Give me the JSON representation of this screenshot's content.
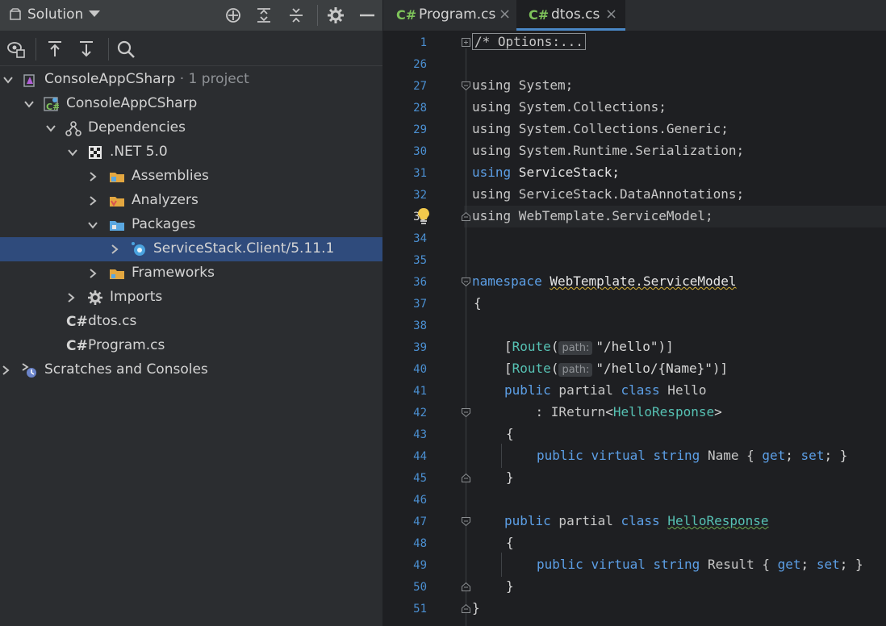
{
  "solution": {
    "title": "Solution"
  },
  "tree": [
    {
      "label": "ConsoleAppCSharp",
      "suffix": " · 1 project"
    },
    {
      "label": "ConsoleAppCSharp"
    },
    {
      "label": "Dependencies"
    },
    {
      "label": ".NET 5.0"
    },
    {
      "label": "Assemblies"
    },
    {
      "label": "Analyzers"
    },
    {
      "label": "Packages"
    },
    {
      "label": "ServiceStack.Client/5.11.1"
    },
    {
      "label": "Frameworks"
    },
    {
      "label": "Imports"
    },
    {
      "label": "dtos.cs",
      "badge": "C#"
    },
    {
      "label": "Program.cs",
      "badge": "C#"
    },
    {
      "label": "Scratches and Consoles"
    }
  ],
  "tabs": [
    {
      "badge": "C#",
      "name": "Program.cs",
      "close": "×"
    },
    {
      "badge": "C#",
      "name": "dtos.cs",
      "close": "×"
    }
  ],
  "line_numbers": [
    "1",
    "26",
    "27",
    "28",
    "29",
    "30",
    "31",
    "32",
    "33",
    "34",
    "35",
    "36",
    "37",
    "38",
    "39",
    "40",
    "41",
    "42",
    "43",
    "44",
    "45",
    "46",
    "47",
    "48",
    "49",
    "50",
    "51"
  ],
  "code": {
    "l1": "/* Options:...",
    "using": "using",
    "l27": " System;",
    "l28": " System.Collections;",
    "l29": " System.Collections.Generic;",
    "l30": " System.Runtime.Serialization;",
    "l31": " ServiceStack;",
    "l32": " ServiceStack.DataAnnotations;",
    "l33": " WebTemplate.ServiceModel;",
    "namespace": "namespace",
    "ns_name": "WebTemplate.ServiceModel",
    "open_brace": "{",
    "close_brace": "}",
    "route_open": "[",
    "route": "Route",
    "paren_open": "(",
    "path_hint": "path:",
    "route1": "\"/hello\"",
    "route2": "\"/hello/{Name}\"",
    "route_close": ")]",
    "public": "public",
    "partial": " partial ",
    "class": "class",
    "hello": " Hello",
    "colon": "    : ",
    "ireturn": "IReturn",
    "lt": "<",
    "hello_response": "HelloResponse",
    "gt": ">",
    "virtual": "virtual",
    "string": "string",
    "name_prop": " Name { ",
    "result_prop": " Result { ",
    "get": "get",
    "set": "set",
    "semi": "; ",
    "semi_end": "; }"
  },
  "colors": {
    "keyword": "#5c9fe6",
    "type": "#56c1b3",
    "selection": "#2f4b7c",
    "csharp_badge": "#7ec35a"
  },
  "icons": [
    "solution-icon",
    "locate-icon",
    "expand-all-icon",
    "collapse-all-icon",
    "gear-icon",
    "minimize-icon",
    "show-hidden-icon",
    "upload-icon",
    "download-icon",
    "search-icon",
    "lightbulb-icon"
  ]
}
